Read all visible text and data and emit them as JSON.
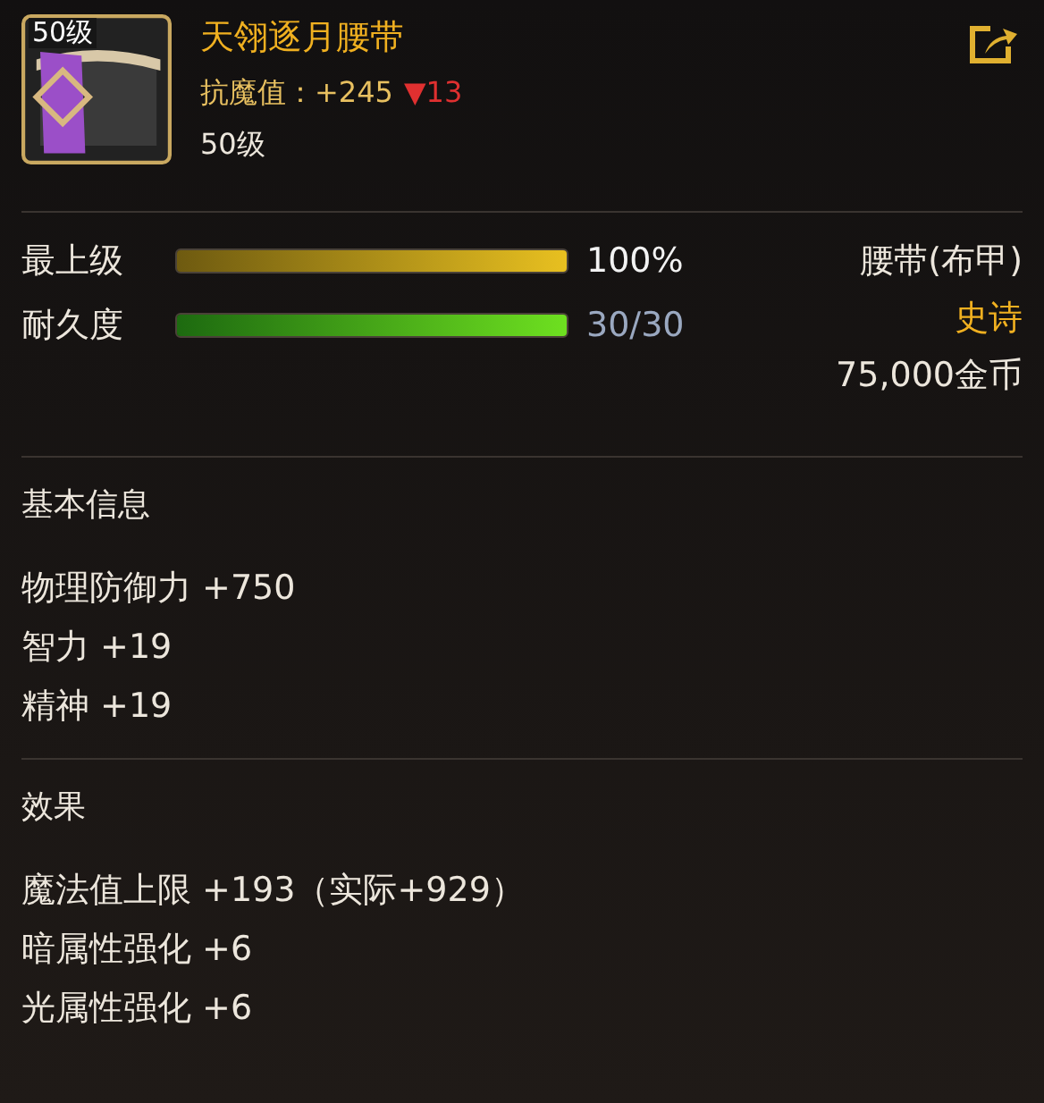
{
  "item": {
    "icon_badge": "50级",
    "name": "天翎逐月腰带",
    "stat_label": "抗魔值：+245",
    "stat_change": "▼13",
    "stat_decreased": true,
    "level": "50级"
  },
  "bars": [
    {
      "label": "最上级",
      "kind": "quality",
      "level": 1.0,
      "reading": "100%"
    },
    {
      "label": "耐久度",
      "kind": "durability",
      "level": 1.0,
      "reading": "30/30"
    }
  ],
  "side": {
    "type": "腰带(布甲)",
    "rarity": "史诗",
    "price": "75,000金币"
  },
  "sections": [
    {
      "title": "基本信息",
      "lines": [
        "物理防御力 +750",
        "智力 +19",
        "精神 +19"
      ]
    },
    {
      "title": "效果",
      "lines": [
        "魔法值上限 +193（实际+929）",
        "暗属性强化 +6",
        "光属性强化 +6"
      ]
    }
  ]
}
